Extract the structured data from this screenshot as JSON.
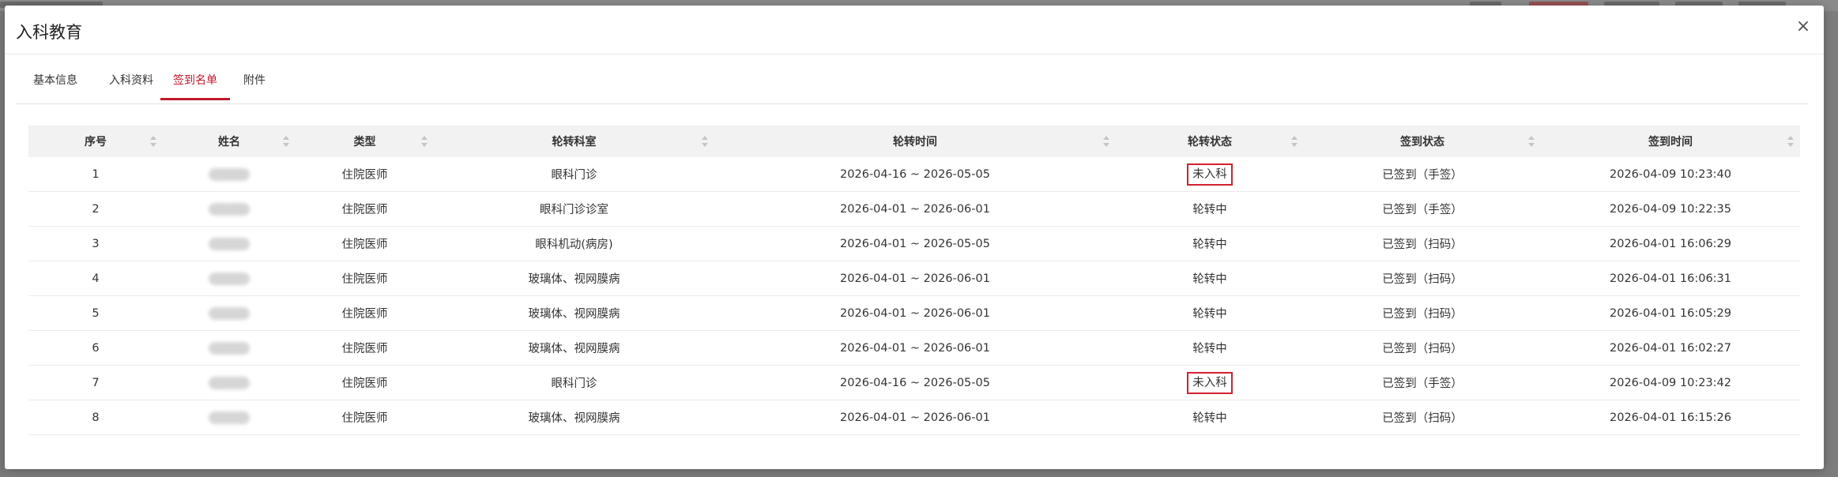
{
  "modal": {
    "title": "入科教育",
    "close_symbol": "×"
  },
  "tabs": [
    {
      "label": "基本信息",
      "active": false
    },
    {
      "label": "入科资料",
      "active": false
    },
    {
      "label": "签到名单",
      "active": true
    },
    {
      "label": "附件",
      "active": false
    }
  ],
  "table": {
    "headers": [
      "序号",
      "姓名",
      "类型",
      "轮转科室",
      "轮转时间",
      "轮转状态",
      "签到状态",
      "签到时间"
    ],
    "rows": [
      {
        "idx": "1",
        "type": "住院医师",
        "dept": "眼科门诊",
        "time": "2026-04-16 ~ 2026-05-05",
        "status": "未入科",
        "sign": "已签到（手签）",
        "sign_time": "2026-04-09 10:23:40",
        "highlight": true
      },
      {
        "idx": "2",
        "type": "住院医师",
        "dept": "眼科门诊诊室",
        "time": "2026-04-01 ~ 2026-06-01",
        "status": "轮转中",
        "sign": "已签到（手签）",
        "sign_time": "2026-04-09 10:22:35",
        "highlight": false
      },
      {
        "idx": "3",
        "type": "住院医师",
        "dept": "眼科机动(病房)",
        "time": "2026-04-01 ~ 2026-05-05",
        "status": "轮转中",
        "sign": "已签到（扫码）",
        "sign_time": "2026-04-01 16:06:29",
        "highlight": false
      },
      {
        "idx": "4",
        "type": "住院医师",
        "dept": "玻璃体、视网膜病",
        "time": "2026-04-01 ~ 2026-06-01",
        "status": "轮转中",
        "sign": "已签到（扫码）",
        "sign_time": "2026-04-01 16:06:31",
        "highlight": false
      },
      {
        "idx": "5",
        "type": "住院医师",
        "dept": "玻璃体、视网膜病",
        "time": "2026-04-01 ~ 2026-06-01",
        "status": "轮转中",
        "sign": "已签到（扫码）",
        "sign_time": "2026-04-01 16:05:29",
        "highlight": false
      },
      {
        "idx": "6",
        "type": "住院医师",
        "dept": "玻璃体、视网膜病",
        "time": "2026-04-01 ~ 2026-06-01",
        "status": "轮转中",
        "sign": "已签到（扫码）",
        "sign_time": "2026-04-01 16:02:27",
        "highlight": false
      },
      {
        "idx": "7",
        "type": "住院医师",
        "dept": "眼科门诊",
        "time": "2026-04-16 ~ 2026-05-05",
        "status": "未入科",
        "sign": "已签到（手签）",
        "sign_time": "2026-04-09 10:23:42",
        "highlight": true
      },
      {
        "idx": "8",
        "type": "住院医师",
        "dept": "玻璃体、视网膜病",
        "time": "2026-04-01 ~ 2026-06-01",
        "status": "轮转中",
        "sign": "已签到（扫码）",
        "sign_time": "2026-04-01 16:15:26",
        "highlight": false
      }
    ]
  },
  "colors": {
    "accent": "#c0182c",
    "highlight_border": "#d4202f",
    "header_bg": "#f2f2f2",
    "overlay": "#7d7d7d"
  }
}
